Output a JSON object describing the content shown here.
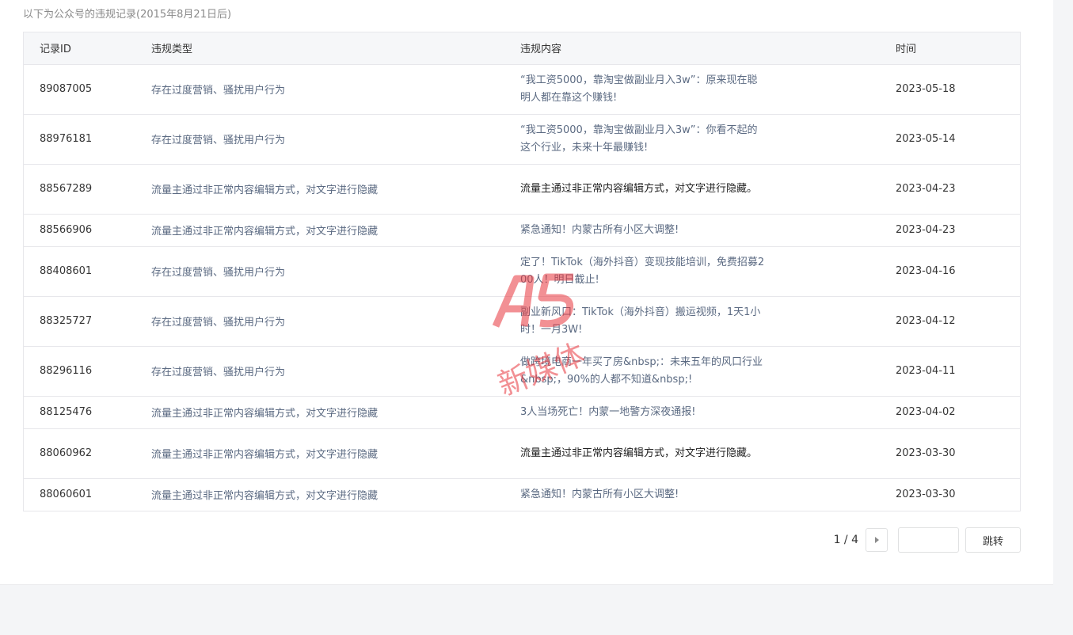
{
  "caption": "以下为公众号的违规记录(2015年8月21日后)",
  "table": {
    "headers": {
      "id": "记录ID",
      "type": "违规类型",
      "content": "违规内容",
      "time": "时间"
    },
    "rows": [
      {
        "id": "89087005",
        "type": "存在过度营销、骚扰用户行为",
        "content": "“我工资5000，靠淘宝做副业月入3w”：原来现在聪明人都在靠这个赚钱!",
        "time": "2023-05-18"
      },
      {
        "id": "88976181",
        "type": "存在过度营销、骚扰用户行为",
        "content": "“我工资5000，靠淘宝做副业月入3w”：你看不起的这个行业，未来十年最赚钱!",
        "time": "2023-05-14"
      },
      {
        "id": "88567289",
        "type": "流量主通过非正常内容编辑方式，对文字进行隐藏",
        "content": "流量主通过非正常内容编辑方式，对文字进行隐藏。",
        "time": "2023-04-23"
      },
      {
        "id": "88566906",
        "type": "流量主通过非正常内容编辑方式，对文字进行隐藏",
        "content": "紧急通知！内蒙古所有小区大调整!",
        "time": "2023-04-23"
      },
      {
        "id": "88408601",
        "type": "存在过度营销、骚扰用户行为",
        "content": "定了！TikTok（海外抖音）变现技能培训，免费招募200人！明日截止!",
        "time": "2023-04-16"
      },
      {
        "id": "88325727",
        "type": "存在过度营销、骚扰用户行为",
        "content": "副业新风口：TikTok（海外抖音）搬运视频，1天1小时！一月3W!",
        "time": "2023-04-12"
      },
      {
        "id": "88296116",
        "type": "存在过度营销、骚扰用户行为",
        "content": "做跨境电商一年买了房&nbsp;：未来五年的风口行业&nbsp;，90%的人都不知道&nbsp;!",
        "time": "2023-04-11"
      },
      {
        "id": "88125476",
        "type": "流量主通过非正常内容编辑方式，对文字进行隐藏",
        "content": "3人当场死亡！内蒙一地警方深夜通报!",
        "time": "2023-04-02"
      },
      {
        "id": "88060962",
        "type": "流量主通过非正常内容编辑方式，对文字进行隐藏",
        "content": "流量主通过非正常内容编辑方式，对文字进行隐藏。",
        "time": "2023-03-30"
      },
      {
        "id": "88060601",
        "type": "流量主通过非正常内容编辑方式，对文字进行隐藏",
        "content": "紧急通知！内蒙古所有小区大调整!",
        "time": "2023-03-30"
      }
    ]
  },
  "pager": {
    "info": "1 / 4",
    "next_icon": "caret-right-icon",
    "jump_value": "",
    "jump_label": "跳转"
  },
  "watermark": {
    "logo_text": "A5",
    "text": "新媒体",
    "color": "#e8363d"
  }
}
